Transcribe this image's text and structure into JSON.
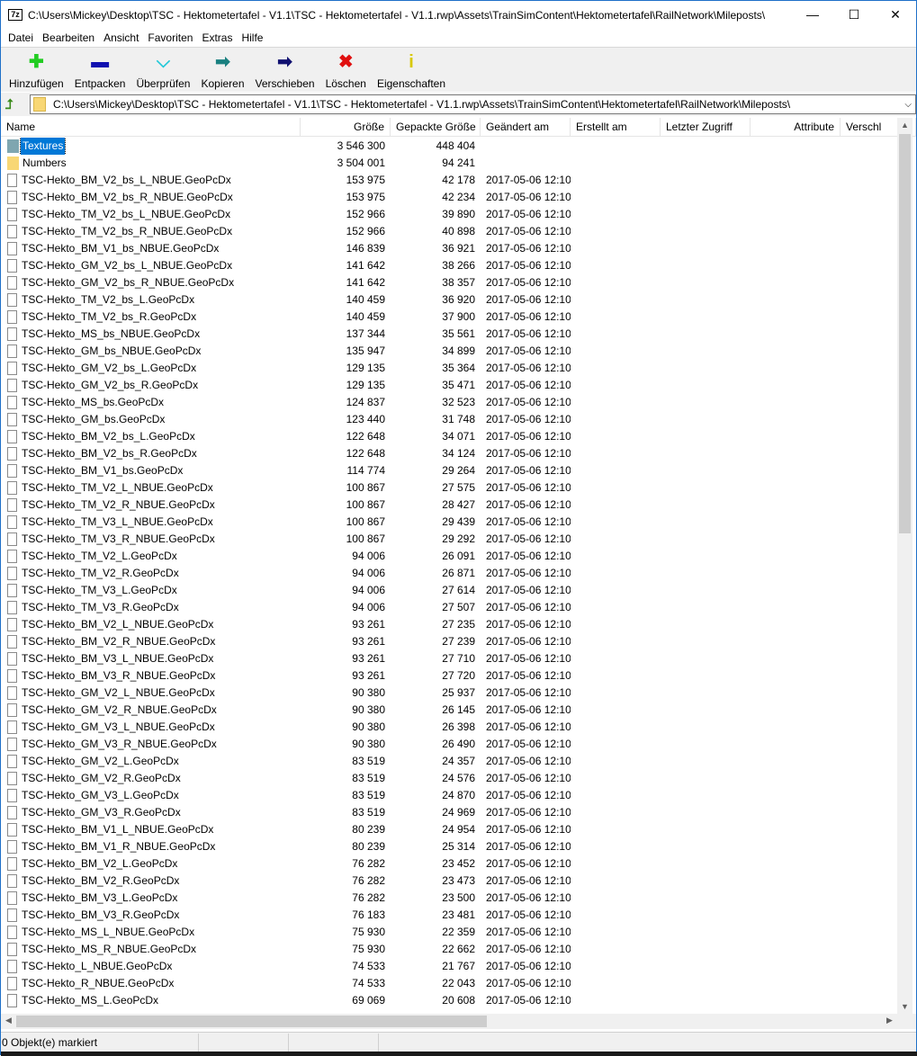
{
  "window": {
    "title": "C:\\Users\\Mickey\\Desktop\\TSC - Hektometertafel - V1.1\\TSC - Hektometertafel - V1.1.rwp\\Assets\\TrainSimContent\\Hektometertafel\\RailNetwork\\Mileposts\\",
    "app_icon": "7z",
    "minimize": "—",
    "maximize": "☐",
    "close": "✕"
  },
  "menu": [
    "Datei",
    "Bearbeiten",
    "Ansicht",
    "Favoriten",
    "Extras",
    "Hilfe"
  ],
  "toolbar": [
    {
      "label": "Hinzufügen",
      "icon": "plus-icon",
      "glyph": "✚",
      "color": "#22cc22"
    },
    {
      "label": "Entpacken",
      "icon": "minus-icon",
      "glyph": "▬",
      "color": "#1010b0"
    },
    {
      "label": "Überprüfen",
      "icon": "check-chevron-icon",
      "glyph": "⌵",
      "color": "#20c8d8"
    },
    {
      "label": "Kopieren",
      "icon": "copy-arrow-icon",
      "glyph": "➡",
      "color": "#1a8080"
    },
    {
      "label": "Verschieben",
      "icon": "move-arrow-icon",
      "glyph": "➡",
      "color": "#101070"
    },
    {
      "label": "Löschen",
      "icon": "delete-x-icon",
      "glyph": "✖",
      "color": "#e01010"
    },
    {
      "label": "Eigenschaften",
      "icon": "info-icon",
      "glyph": "i",
      "color": "#d8c800"
    }
  ],
  "address": {
    "path": "C:\\Users\\Mickey\\Desktop\\TSC - Hektometertafel - V1.1\\TSC - Hektometertafel - V1.1.rwp\\Assets\\TrainSimContent\\Hektometertafel\\RailNetwork\\Mileposts\\"
  },
  "columns": {
    "name": "Name",
    "size": "Größe",
    "packed": "Gepackte Größe",
    "modified": "Geändert am",
    "created": "Erstellt am",
    "accessed": "Letzter Zugriff",
    "attributes": "Attribute",
    "encrypted": "Verschl"
  },
  "folders": [
    {
      "name": "Textures",
      "size": "3 546 300",
      "packed": "448 404",
      "selected": true
    },
    {
      "name": "Numbers",
      "size": "3 504 001",
      "packed": "94 241",
      "selected": false
    }
  ],
  "files": [
    [
      "TSC-Hekto_BM_V2_bs_L_NBUE.GeoPcDx",
      "153 975",
      "42 178",
      "2017-05-06 12:10"
    ],
    [
      "TSC-Hekto_BM_V2_bs_R_NBUE.GeoPcDx",
      "153 975",
      "42 234",
      "2017-05-06 12:10"
    ],
    [
      "TSC-Hekto_TM_V2_bs_L_NBUE.GeoPcDx",
      "152 966",
      "39 890",
      "2017-05-06 12:10"
    ],
    [
      "TSC-Hekto_TM_V2_bs_R_NBUE.GeoPcDx",
      "152 966",
      "40 898",
      "2017-05-06 12:10"
    ],
    [
      "TSC-Hekto_BM_V1_bs_NBUE.GeoPcDx",
      "146 839",
      "36 921",
      "2017-05-06 12:10"
    ],
    [
      "TSC-Hekto_GM_V2_bs_L_NBUE.GeoPcDx",
      "141 642",
      "38 266",
      "2017-05-06 12:10"
    ],
    [
      "TSC-Hekto_GM_V2_bs_R_NBUE.GeoPcDx",
      "141 642",
      "38 357",
      "2017-05-06 12:10"
    ],
    [
      "TSC-Hekto_TM_V2_bs_L.GeoPcDx",
      "140 459",
      "36 920",
      "2017-05-06 12:10"
    ],
    [
      "TSC-Hekto_TM_V2_bs_R.GeoPcDx",
      "140 459",
      "37 900",
      "2017-05-06 12:10"
    ],
    [
      "TSC-Hekto_MS_bs_NBUE.GeoPcDx",
      "137 344",
      "35 561",
      "2017-05-06 12:10"
    ],
    [
      "TSC-Hekto_GM_bs_NBUE.GeoPcDx",
      "135 947",
      "34 899",
      "2017-05-06 12:10"
    ],
    [
      "TSC-Hekto_GM_V2_bs_L.GeoPcDx",
      "129 135",
      "35 364",
      "2017-05-06 12:10"
    ],
    [
      "TSC-Hekto_GM_V2_bs_R.GeoPcDx",
      "129 135",
      "35 471",
      "2017-05-06 12:10"
    ],
    [
      "TSC-Hekto_MS_bs.GeoPcDx",
      "124 837",
      "32 523",
      "2017-05-06 12:10"
    ],
    [
      "TSC-Hekto_GM_bs.GeoPcDx",
      "123 440",
      "31 748",
      "2017-05-06 12:10"
    ],
    [
      "TSC-Hekto_BM_V2_bs_L.GeoPcDx",
      "122 648",
      "34 071",
      "2017-05-06 12:10"
    ],
    [
      "TSC-Hekto_BM_V2_bs_R.GeoPcDx",
      "122 648",
      "34 124",
      "2017-05-06 12:10"
    ],
    [
      "TSC-Hekto_BM_V1_bs.GeoPcDx",
      "114 774",
      "29 264",
      "2017-05-06 12:10"
    ],
    [
      "TSC-Hekto_TM_V2_L_NBUE.GeoPcDx",
      "100 867",
      "27 575",
      "2017-05-06 12:10"
    ],
    [
      "TSC-Hekto_TM_V2_R_NBUE.GeoPcDx",
      "100 867",
      "28 427",
      "2017-05-06 12:10"
    ],
    [
      "TSC-Hekto_TM_V3_L_NBUE.GeoPcDx",
      "100 867",
      "29 439",
      "2017-05-06 12:10"
    ],
    [
      "TSC-Hekto_TM_V3_R_NBUE.GeoPcDx",
      "100 867",
      "29 292",
      "2017-05-06 12:10"
    ],
    [
      "TSC-Hekto_TM_V2_L.GeoPcDx",
      "94 006",
      "26 091",
      "2017-05-06 12:10"
    ],
    [
      "TSC-Hekto_TM_V2_R.GeoPcDx",
      "94 006",
      "26 871",
      "2017-05-06 12:10"
    ],
    [
      "TSC-Hekto_TM_V3_L.GeoPcDx",
      "94 006",
      "27 614",
      "2017-05-06 12:10"
    ],
    [
      "TSC-Hekto_TM_V3_R.GeoPcDx",
      "94 006",
      "27 507",
      "2017-05-06 12:10"
    ],
    [
      "TSC-Hekto_BM_V2_L_NBUE.GeoPcDx",
      "93 261",
      "27 235",
      "2017-05-06 12:10"
    ],
    [
      "TSC-Hekto_BM_V2_R_NBUE.GeoPcDx",
      "93 261",
      "27 239",
      "2017-05-06 12:10"
    ],
    [
      "TSC-Hekto_BM_V3_L_NBUE.GeoPcDx",
      "93 261",
      "27 710",
      "2017-05-06 12:10"
    ],
    [
      "TSC-Hekto_BM_V3_R_NBUE.GeoPcDx",
      "93 261",
      "27 720",
      "2017-05-06 12:10"
    ],
    [
      "TSC-Hekto_GM_V2_L_NBUE.GeoPcDx",
      "90 380",
      "25 937",
      "2017-05-06 12:10"
    ],
    [
      "TSC-Hekto_GM_V2_R_NBUE.GeoPcDx",
      "90 380",
      "26 145",
      "2017-05-06 12:10"
    ],
    [
      "TSC-Hekto_GM_V3_L_NBUE.GeoPcDx",
      "90 380",
      "26 398",
      "2017-05-06 12:10"
    ],
    [
      "TSC-Hekto_GM_V3_R_NBUE.GeoPcDx",
      "90 380",
      "26 490",
      "2017-05-06 12:10"
    ],
    [
      "TSC-Hekto_GM_V2_L.GeoPcDx",
      "83 519",
      "24 357",
      "2017-05-06 12:10"
    ],
    [
      "TSC-Hekto_GM_V2_R.GeoPcDx",
      "83 519",
      "24 576",
      "2017-05-06 12:10"
    ],
    [
      "TSC-Hekto_GM_V3_L.GeoPcDx",
      "83 519",
      "24 870",
      "2017-05-06 12:10"
    ],
    [
      "TSC-Hekto_GM_V3_R.GeoPcDx",
      "83 519",
      "24 969",
      "2017-05-06 12:10"
    ],
    [
      "TSC-Hekto_BM_V1_L_NBUE.GeoPcDx",
      "80 239",
      "24 954",
      "2017-05-06 12:10"
    ],
    [
      "TSC-Hekto_BM_V1_R_NBUE.GeoPcDx",
      "80 239",
      "25 314",
      "2017-05-06 12:10"
    ],
    [
      "TSC-Hekto_BM_V2_L.GeoPcDx",
      "76 282",
      "23 452",
      "2017-05-06 12:10"
    ],
    [
      "TSC-Hekto_BM_V2_R.GeoPcDx",
      "76 282",
      "23 473",
      "2017-05-06 12:10"
    ],
    [
      "TSC-Hekto_BM_V3_L.GeoPcDx",
      "76 282",
      "23 500",
      "2017-05-06 12:10"
    ],
    [
      "TSC-Hekto_BM_V3_R.GeoPcDx",
      "76 183",
      "23 481",
      "2017-05-06 12:10"
    ],
    [
      "TSC-Hekto_MS_L_NBUE.GeoPcDx",
      "75 930",
      "22 359",
      "2017-05-06 12:10"
    ],
    [
      "TSC-Hekto_MS_R_NBUE.GeoPcDx",
      "75 930",
      "22 662",
      "2017-05-06 12:10"
    ],
    [
      "TSC-Hekto_L_NBUE.GeoPcDx",
      "74 533",
      "21 767",
      "2017-05-06 12:10"
    ],
    [
      "TSC-Hekto_R_NBUE.GeoPcDx",
      "74 533",
      "22 043",
      "2017-05-06 12:10"
    ],
    [
      "TSC-Hekto_MS_L.GeoPcDx",
      "69 069",
      "20 608",
      "2017-05-06 12:10"
    ]
  ],
  "status": {
    "selection": "0 Objekt(e) markiert"
  }
}
